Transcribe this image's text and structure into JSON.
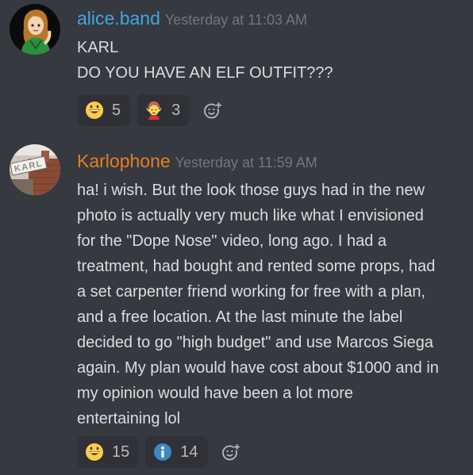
{
  "messages": [
    {
      "username": "alice.band",
      "username_color": "#3ea6e8",
      "timestamp": "Yesterday at 11:03 AM",
      "lines": [
        "KARL",
        "DO YOU HAVE AN ELF OUTFIT???"
      ],
      "reactions": [
        {
          "emoji": "grinning-face-icon",
          "count": "5"
        },
        {
          "emoji": "elf-icon",
          "count": "3"
        }
      ]
    },
    {
      "username": "Karlophone",
      "username_color": "#e67e22",
      "timestamp": "Yesterday at 11:59 AM",
      "lines": [
        "ha! i wish.  But the look those guys had in the new",
        "photo is actually very much like what I envisioned",
        "for the \"Dope Nose\" video, long ago. I had a",
        "treatment, had bought and rented some props, had",
        "a set carpenter friend working for free with a plan,",
        "and a free location. At the last minute the label",
        "decided to go \"high budget\" and use Marcos Siega",
        "again. My plan would have cost about $1000 and in",
        "my opinion would have been a lot more",
        "entertaining lol"
      ],
      "avatar_text": "KARL",
      "reactions": [
        {
          "emoji": "grinning-face-icon",
          "count": "15"
        },
        {
          "emoji": "information-icon",
          "count": "14"
        }
      ]
    }
  ],
  "colors": {
    "background": "#36393f",
    "reaction_bg": "#2f3136",
    "timestamp": "#72767d",
    "text": "#dcddde"
  }
}
